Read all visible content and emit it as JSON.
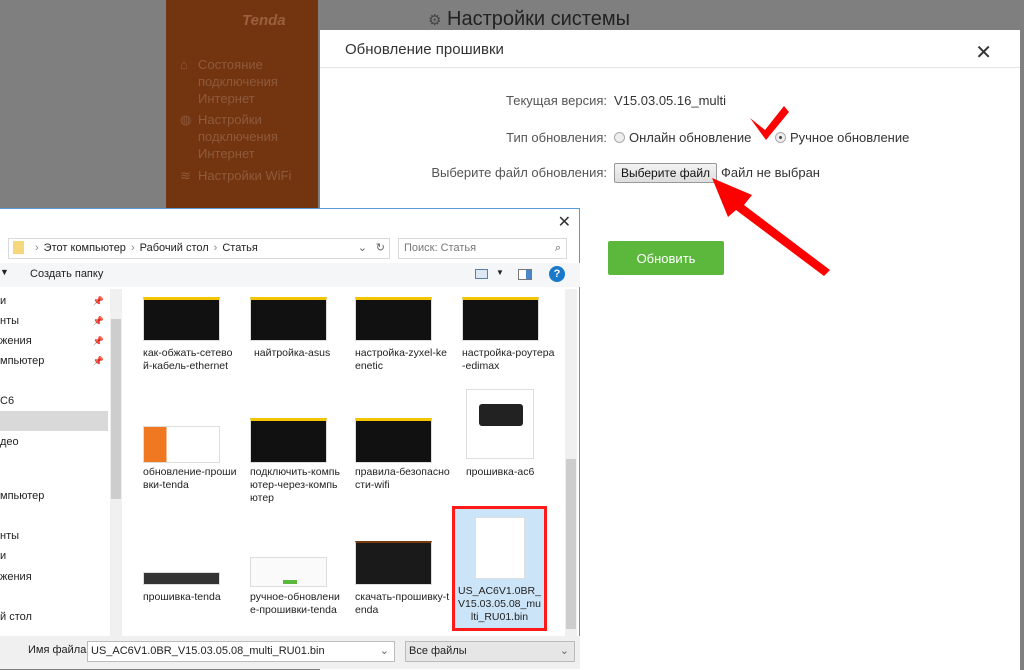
{
  "router": {
    "logo": "Tenda",
    "sidebar": [
      "Состояние подключения Интернет",
      "Настройки подключения Интернет",
      "Настройки WiFi"
    ],
    "page_title": "Настройки системы"
  },
  "modal": {
    "title": "Обновление прошивки",
    "close": "✕",
    "version_label": "Текущая версия:",
    "version_value": "V15.03.05.16_multi",
    "type_label": "Тип обновления:",
    "online": "Онлайн обновление",
    "manual": "Ручное обновление",
    "file_label": "Выберите файл обновления:",
    "choose_file": "Выберите файл",
    "no_file": "Файл не выбран",
    "update": "Обновить",
    "accent": "#5cb83c"
  },
  "dialog": {
    "close": "✕",
    "breadcrumb": [
      "Этот компьютер",
      "Рабочий стол",
      "Статья"
    ],
    "search_placeholder": "Поиск: Статья",
    "new_folder": "Создать папку",
    "help": "?",
    "nav": [
      "и",
      "нты",
      "жения",
      "мпьютер",
      "С6",
      "",
      "део",
      "мпьютер",
      "нты",
      "и",
      "жения",
      "й стол"
    ],
    "files": [
      "как-обжать-сетевой-кабель-ethernet",
      "найтройка-asus",
      "настройка-zyxel-keenetic",
      "настройка-роутера-edimax",
      "обновление-прошивки-tenda",
      "подключить-компьютер-через-компьютер",
      "правила-безопасности-wifi",
      "прошивка-ac6",
      "прошивка-tenda",
      "ручное-обновление-прошивки-tenda",
      "скачать-прошивку-tenda",
      "US_AC6V1.0BR_V15.03.05.08_multi_RU01.bin"
    ],
    "filename_label": "Имя файла:",
    "filename_value": "US_AC6V1.0BR_V15.03.05.08_multi_RU01.bin",
    "filter": "Все файлы"
  }
}
